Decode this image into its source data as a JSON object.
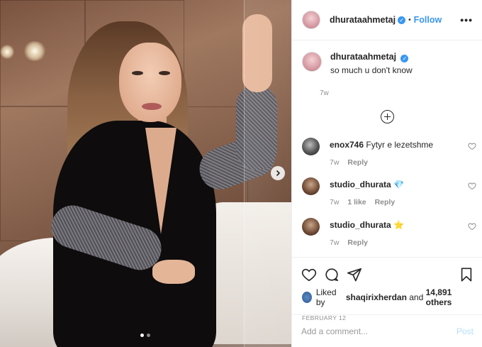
{
  "post": {
    "username": "dhurataahmetaj",
    "follow_label": "Follow",
    "follow_separator": "•",
    "more_label": "•••",
    "caption_text": "so much u don't know",
    "caption_time": "7w",
    "image_page": 1,
    "image_count": 2
  },
  "comments": [
    {
      "username": "enox746",
      "text": "Fytyr e lezetshme",
      "time": "7w",
      "likes": "",
      "reply_label": "Reply"
    },
    {
      "username": "studio_dhurata",
      "text": "💎",
      "time": "7w",
      "likes": "1 like",
      "reply_label": "Reply"
    },
    {
      "username": "studio_dhurata",
      "text": "⭐",
      "time": "7w",
      "likes": "",
      "reply_label": "Reply"
    }
  ],
  "likes": {
    "prefix": "Liked by",
    "user": "shaqirixherdan",
    "and": "and",
    "others": "14,891 others"
  },
  "date": "FEBRUARY 12",
  "composer": {
    "placeholder": "Add a comment...",
    "post_label": "Post"
  },
  "colors": {
    "accent": "#3897f0",
    "post_disabled": "#b2dffc",
    "muted": "#8e8e8e"
  },
  "icons": [
    "verified-badge-icon",
    "more-options-icon",
    "load-more-plus-icon",
    "heart-icon",
    "comment-icon",
    "share-icon",
    "bookmark-icon",
    "next-arrow-icon"
  ]
}
